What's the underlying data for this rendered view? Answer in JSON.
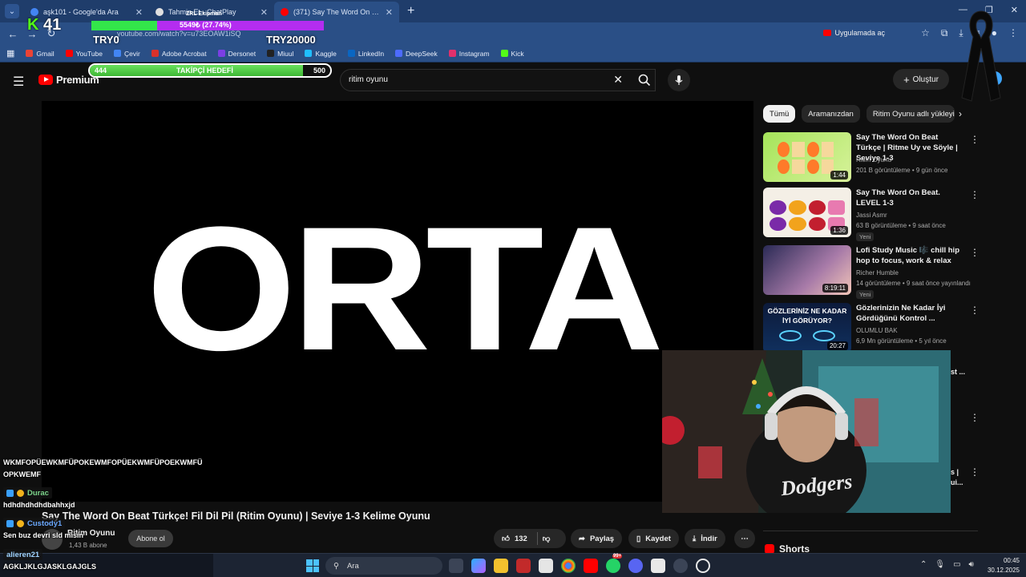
{
  "browser": {
    "tabs": [
      {
        "title": "aşk101 - Google'da Ara",
        "color": "#4285f4",
        "active": false
      },
      {
        "title": "Tahmin Et - ChatPlay",
        "color": "#e0e0e0",
        "active": false
      },
      {
        "title": "(371) Say The Word On Beat Tü",
        "color": "#ff0000",
        "active": true
      }
    ],
    "url": "youtube.com/watch?v=u73EOAW1iSQ",
    "open_in_app": "Uygulamada aç",
    "bookmarks": [
      {
        "label": "Gmail",
        "color": "#ea4335"
      },
      {
        "label": "YouTube",
        "color": "#ff0000"
      },
      {
        "label": "Çevir",
        "color": "#4285f4"
      },
      {
        "label": "Adobe Acrobat",
        "color": "#d9312b"
      },
      {
        "label": "Dersonet",
        "color": "#7b3fe4"
      },
      {
        "label": "Miuul",
        "color": "#222222"
      },
      {
        "label": "Kaggle",
        "color": "#20beff"
      },
      {
        "label": "LinkedIn",
        "color": "#0a66c2"
      },
      {
        "label": "DeepSeek",
        "color": "#4d6bfe"
      },
      {
        "label": "Instagram",
        "color": "#e1306c"
      },
      {
        "label": "Kick",
        "color": "#53fc18"
      }
    ]
  },
  "overlay": {
    "kick_count": "41",
    "progress_label": "5549₺ (27.74%)",
    "progress_pct": 27.74,
    "name_label": "ZRL Ekipman",
    "try_start": "TRY0",
    "try_goal": "TRY20000",
    "follow_goal": {
      "current": "444",
      "title": "TAKİPÇİ HEDEFİ",
      "target": "500",
      "pct": 88.8
    }
  },
  "youtube": {
    "logo_text": "Premium",
    "search_query": "ritim oyunu",
    "create_label": "Oluştur",
    "video_word": "ORTA",
    "video_title": "Say The Word On Beat Türkçe! Fil Dil Pil (Ritim Oyunu) | Seviye 1-3 Kelime Oyunu",
    "channel": "Ritim Oyunu",
    "subscribers": "1,43 B abone",
    "subscribe_label": "Abone ol",
    "likes": "132",
    "share_label": "Paylaş",
    "save_label": "Kaydet",
    "download_label": "İndir",
    "chips": [
      "Tümü",
      "Aramanızdan",
      "Ritim Oyunu adlı yükleyi"
    ],
    "shorts_label": "Shorts",
    "recommendations": [
      {
        "title": "Say The Word On Beat Türkçe | Ritme Uy ve Söyle | Seviye 1-3",
        "channel": "Ritim Oyunu",
        "meta": "201 B görüntüleme • 9 gün önce",
        "duration": "1:44",
        "badge": ""
      },
      {
        "title": "Say The Word On Beat. LEVEL 1-3",
        "channel": "Jassi Asmr",
        "meta": "63 B görüntüleme • 9 saat önce",
        "duration": "1:36",
        "badge": "Yeni"
      },
      {
        "title": "Lofi Study Music 🎼 chill hip hop to focus, work & relax",
        "channel": "Richer Humble",
        "meta": "14 görüntüleme • 9 saat önce yayınlandı",
        "duration": "8:19:11",
        "badge": "Yeni"
      },
      {
        "title": "Gözlerinizin Ne Kadar İyi Gördüğünü Kontrol ...",
        "channel": "OLUMLU BAK",
        "meta": "6,9 Mn görüntüleme • 5 yıl önce",
        "duration": "20:27",
        "badge": "",
        "thumb_text": "GÖZLERİNİZ NE KADAR İYİ GÖRÜYOR?"
      }
    ],
    "hidden_titles": [
      "st ...",
      "s |",
      "ui..."
    ]
  },
  "chat": {
    "lines": [
      {
        "type": "text",
        "text": "WKMFOPÜEWKMFÜPOKEWMFOPÜEKWMFÜPOEKWMFÜ"
      },
      {
        "type": "text",
        "text": "OPKWEMF"
      },
      {
        "type": "user",
        "user": "Durac",
        "color": "#7cd38a"
      },
      {
        "type": "text",
        "text": "hdhdhdhdhdbahhxjd"
      },
      {
        "type": "user",
        "user": "Custody1",
        "color": "#6aa8ff"
      },
      {
        "type": "text",
        "text": "Sen buz devri sld misin"
      },
      {
        "type": "user",
        "user": "alieren21",
        "color": "#9fd3ff"
      },
      {
        "type": "text",
        "text": "AGKLJKLGJASKLGAJGLS"
      }
    ]
  },
  "taskbar": {
    "search_label": "Ara",
    "time": "00:45",
    "date": "30.12.2025",
    "badge_count": "99+"
  }
}
